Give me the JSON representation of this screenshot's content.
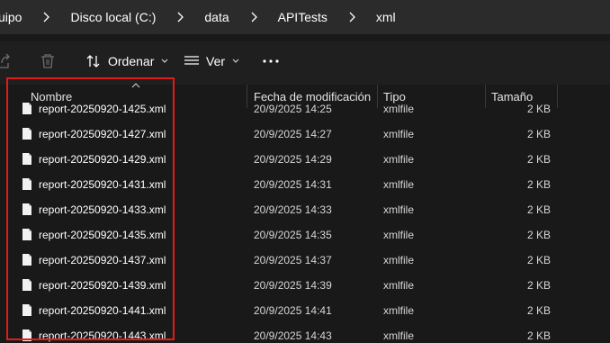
{
  "breadcrumb": {
    "items": [
      "uipo",
      "Disco local (C:)",
      "data",
      "APITests",
      "xml"
    ]
  },
  "toolbar": {
    "sort_label": "Ordenar",
    "view_label": "Ver",
    "icons": [
      "share-icon",
      "delete-icon",
      "sort-icon",
      "view-icon",
      "more-icon"
    ]
  },
  "columns": {
    "name": "Nombre",
    "date": "Fecha de modificación",
    "type": "Tipo",
    "size": "Tamaño"
  },
  "files": [
    {
      "name": "report-20250920-1425.xml",
      "date": "20/9/2025 14:25",
      "type": "xmlfile",
      "size": "2 KB"
    },
    {
      "name": "report-20250920-1427.xml",
      "date": "20/9/2025 14:27",
      "type": "xmlfile",
      "size": "2 KB"
    },
    {
      "name": "report-20250920-1429.xml",
      "date": "20/9/2025 14:29",
      "type": "xmlfile",
      "size": "2 KB"
    },
    {
      "name": "report-20250920-1431.xml",
      "date": "20/9/2025 14:31",
      "type": "xmlfile",
      "size": "2 KB"
    },
    {
      "name": "report-20250920-1433.xml",
      "date": "20/9/2025 14:33",
      "type": "xmlfile",
      "size": "2 KB"
    },
    {
      "name": "report-20250920-1435.xml",
      "date": "20/9/2025 14:35",
      "type": "xmlfile",
      "size": "2 KB"
    },
    {
      "name": "report-20250920-1437.xml",
      "date": "20/9/2025 14:37",
      "type": "xmlfile",
      "size": "2 KB"
    },
    {
      "name": "report-20250920-1439.xml",
      "date": "20/9/2025 14:39",
      "type": "xmlfile",
      "size": "2 KB"
    },
    {
      "name": "report-20250920-1441.xml",
      "date": "20/9/2025 14:41",
      "type": "xmlfile",
      "size": "2 KB"
    },
    {
      "name": "report-20250920-1443.xml",
      "date": "20/9/2025 14:43",
      "type": "xmlfile",
      "size": "2 KB"
    }
  ],
  "colors": {
    "highlight": "#e01b1b",
    "background": "#191919",
    "breadcrumb_bar": "#2b2b2b"
  }
}
